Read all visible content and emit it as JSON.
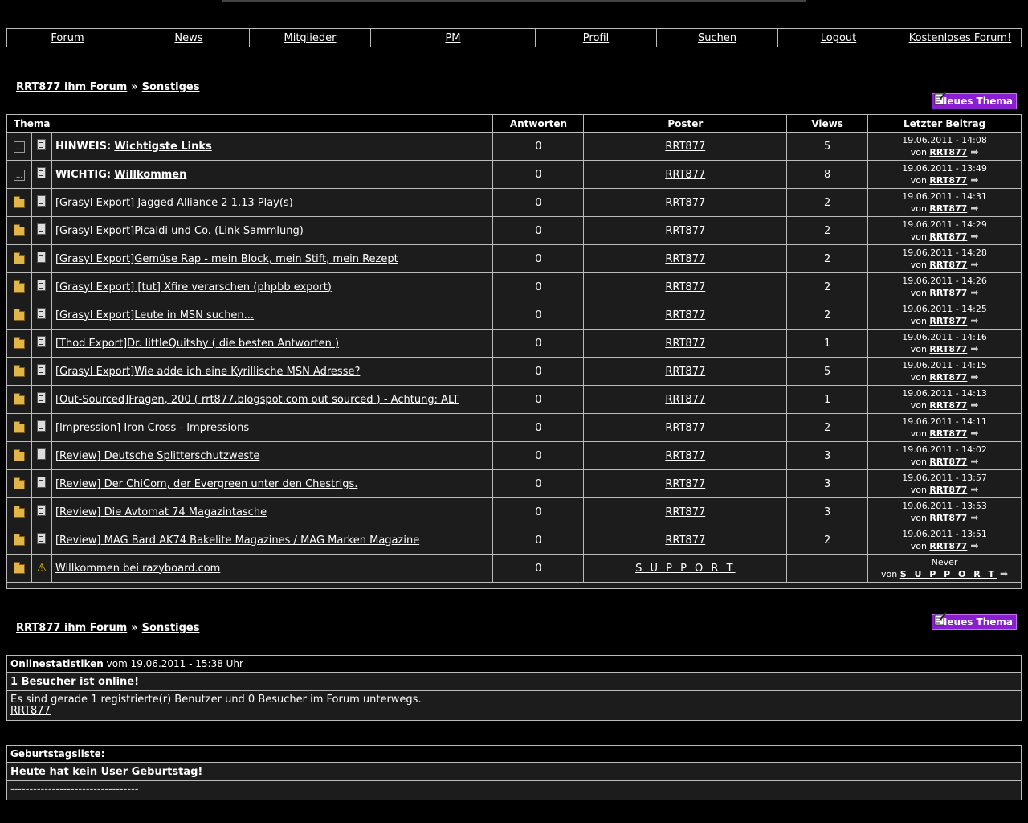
{
  "nav": [
    "Forum",
    "News",
    "Mitglieder",
    "PM",
    "Profil",
    "Suchen",
    "Logout",
    "Kostenloses Forum!"
  ],
  "breadcrumb": {
    "forum": "RRT877 ihm Forum",
    "sep": "»",
    "section": "Sonstiges"
  },
  "new_topic_label": "Neues Thema",
  "table": {
    "headers": [
      "Thema",
      "Antworten",
      "Poster",
      "Views",
      "Letzter Beitrag"
    ],
    "rows": [
      {
        "status": "dots",
        "prefix": "HINWEIS:",
        "title": "Wichtigste Links",
        "replies": "0",
        "poster": "RRT877",
        "views": "5",
        "date": "19.06.2011 - 14:08",
        "by": "RRT877"
      },
      {
        "status": "dots",
        "prefix": "WICHTIG:",
        "title": "Willkommen",
        "replies": "0",
        "poster": "RRT877",
        "views": "8",
        "date": "19.06.2011 - 13:49",
        "by": "RRT877"
      },
      {
        "status": "folder",
        "prefix": "",
        "title": "[Grasyl Export] Jagged Alliance 2 1.13 Play(s)",
        "replies": "0",
        "poster": "RRT877",
        "views": "2",
        "date": "19.06.2011 - 14:31",
        "by": "RRT877"
      },
      {
        "status": "folder",
        "prefix": "",
        "title": "[Grasyl Export]Picaldi und Co. (Link Sammlung)",
        "replies": "0",
        "poster": "RRT877",
        "views": "2",
        "date": "19.06.2011 - 14:29",
        "by": "RRT877"
      },
      {
        "status": "folder",
        "prefix": "",
        "title": "[Grasyl Export]Gemüse Rap - mein Block, mein Stift, mein Rezept",
        "replies": "0",
        "poster": "RRT877",
        "views": "2",
        "date": "19.06.2011 - 14:28",
        "by": "RRT877"
      },
      {
        "status": "folder",
        "prefix": "",
        "title": "[Grasyl Export] [tut] Xfire verarschen (phpbb export)",
        "replies": "0",
        "poster": "RRT877",
        "views": "2",
        "date": "19.06.2011 - 14:26",
        "by": "RRT877"
      },
      {
        "status": "folder",
        "prefix": "",
        "title": "[Grasyl Export]Leute in MSN suchen...",
        "replies": "0",
        "poster": "RRT877",
        "views": "2",
        "date": "19.06.2011 - 14:25",
        "by": "RRT877"
      },
      {
        "status": "folder",
        "prefix": "",
        "title": "[Thod Export]Dr. littleQuitshy ( die besten Antworten )",
        "replies": "0",
        "poster": "RRT877",
        "views": "1",
        "date": "19.06.2011 - 14:16",
        "by": "RRT877"
      },
      {
        "status": "folder",
        "prefix": "",
        "title": "[Grasyl Export]Wie adde ich eine Kyrillische MSN Adresse?",
        "replies": "0",
        "poster": "RRT877",
        "views": "5",
        "date": "19.06.2011 - 14:15",
        "by": "RRT877"
      },
      {
        "status": "folder",
        "prefix": "",
        "title": "[Out-Sourced]Fragen, 200 ( rrt877.blogspot.com out sourced ) - Achtung: ALT",
        "replies": "0",
        "poster": "RRT877",
        "views": "1",
        "date": "19.06.2011 - 14:13",
        "by": "RRT877"
      },
      {
        "status": "folder",
        "prefix": "",
        "title": "[Impression] Iron Cross - Impressions",
        "replies": "0",
        "poster": "RRT877",
        "views": "2",
        "date": "19.06.2011 - 14:11",
        "by": "RRT877"
      },
      {
        "status": "folder",
        "prefix": "",
        "title": "[Review] Deutsche Splitterschutzweste",
        "replies": "0",
        "poster": "RRT877",
        "views": "3",
        "date": "19.06.2011 - 14:02",
        "by": "RRT877"
      },
      {
        "status": "folder",
        "prefix": "",
        "title": "[Review] Der ChiCom, der Evergreen unter den Chestrigs.",
        "replies": "0",
        "poster": "RRT877",
        "views": "3",
        "date": "19.06.2011 - 13:57",
        "by": "RRT877"
      },
      {
        "status": "folder",
        "prefix": "",
        "title": "[Review] Die Avtomat 74 Magazintasche",
        "replies": "0",
        "poster": "RRT877",
        "views": "3",
        "date": "19.06.2011 - 13:53",
        "by": "RRT877"
      },
      {
        "status": "folder",
        "prefix": "",
        "title": "[Review] MAG Bard AK74 Bakelite Magazines / MAG Marken Magazine",
        "replies": "0",
        "poster": "RRT877",
        "views": "2",
        "date": "19.06.2011 - 13:51",
        "by": "RRT877"
      },
      {
        "status": "folder",
        "prefix": "",
        "title": "Willkommen bei razyboard.com",
        "replies": "0",
        "poster": "S U P P O R T",
        "views": "",
        "date": "Never",
        "by": "S U P P O R T",
        "warn": true
      }
    ],
    "by_prefix": "von"
  },
  "online": {
    "title": "Onlinestatistiken",
    "title_suffix": "vom 19.06.2011 - 15:38 Uhr",
    "headline": "1 Besucher ist online!",
    "text": "Es sind gerade 1 registrierte(r) Benutzer und 0 Besucher im Forum unterwegs.",
    "user": "RRT877"
  },
  "birthday": {
    "title": "Geburtstagsliste:",
    "headline": "Heute hat kein User Geburtstag!",
    "text": "----------------------------------"
  },
  "icons": {
    "doc": "document-icon",
    "folder": "folder-icon",
    "dots": "sticky-icon",
    "warn": "warning-icon",
    "arrow": "goto-last-post-icon",
    "new": "new-topic-icon"
  }
}
